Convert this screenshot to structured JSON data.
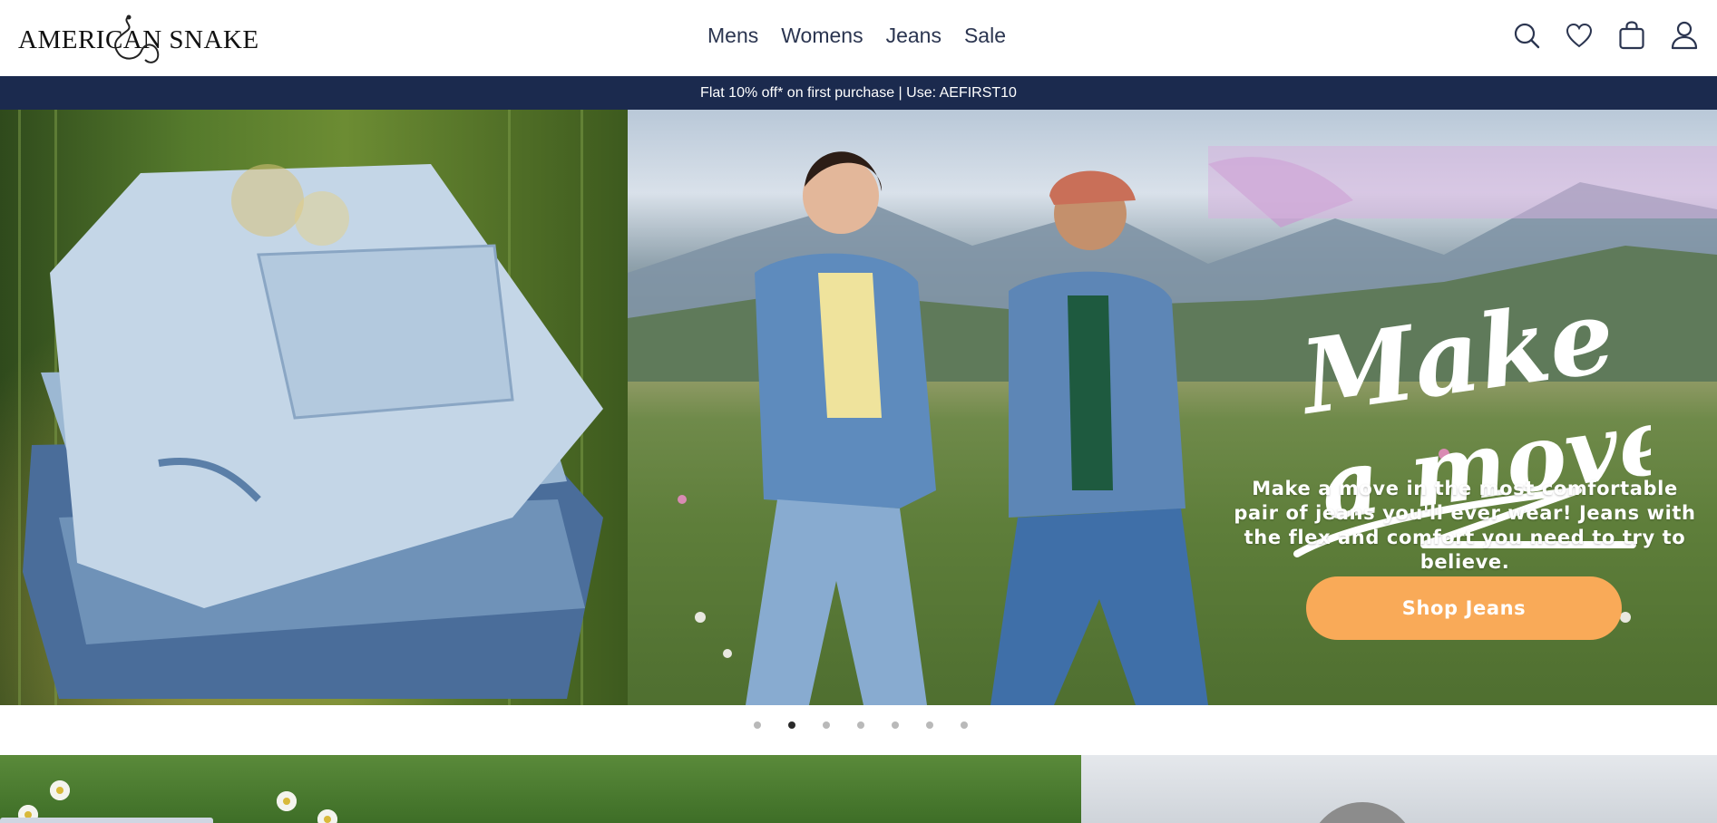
{
  "brand": {
    "name": "AMERICAN SNAKE"
  },
  "nav": {
    "items": [
      "Mens",
      "Womens",
      "Jeans",
      "Sale"
    ]
  },
  "header_icons": [
    "search-icon",
    "heart-icon",
    "bag-icon",
    "user-icon"
  ],
  "promo": {
    "text": "Flat 10% off* on first purchase | Use: AEFIRST10"
  },
  "hero": {
    "headline_line1": "Make",
    "headline_line2": "a move",
    "body": "Make a move in the most comfortable pair of jeans you'll ever wear! Jeans with the flex and comfort you need to try to believe.",
    "cta_label": "Shop Jeans"
  },
  "carousel": {
    "total": 7,
    "active_index": 1
  },
  "colors": {
    "promo_bg": "#1b2a4e",
    "cta_bg": "#f9aa58",
    "nav_text": "#2b3550"
  }
}
